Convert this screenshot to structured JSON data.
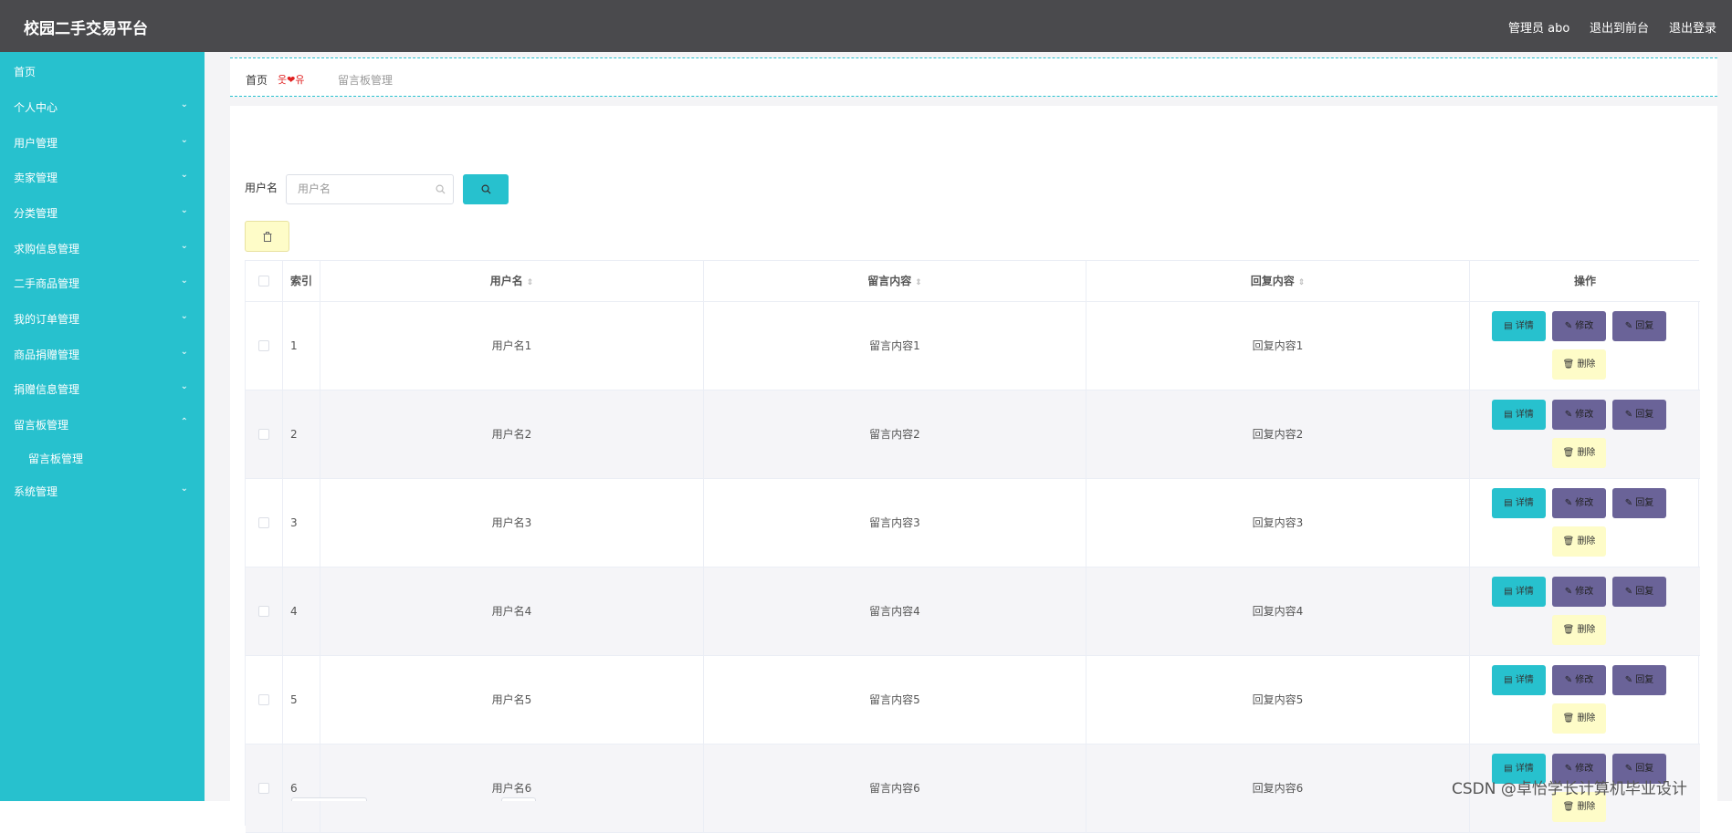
{
  "header": {
    "brand": "校园二手交易平台",
    "admin_label": "管理员 abo",
    "front_link": "退出到前台",
    "logout_link": "退出登录"
  },
  "sidebar": {
    "items": [
      {
        "label": "首页",
        "chevron": ""
      },
      {
        "label": "个人中心",
        "chevron": "⌄"
      },
      {
        "label": "用户管理",
        "chevron": "⌄"
      },
      {
        "label": "卖家管理",
        "chevron": "⌄"
      },
      {
        "label": "分类管理",
        "chevron": "⌄"
      },
      {
        "label": "求购信息管理",
        "chevron": "⌄"
      },
      {
        "label": "二手商品管理",
        "chevron": "⌄"
      },
      {
        "label": "我的订单管理",
        "chevron": "⌄"
      },
      {
        "label": "商品捐赠管理",
        "chevron": "⌄"
      },
      {
        "label": "捐赠信息管理",
        "chevron": "⌄"
      },
      {
        "label": "留言板管理",
        "chevron": "⌃"
      },
      {
        "label": "留言板管理",
        "chevron": ""
      },
      {
        "label": "系统管理",
        "chevron": "⌄"
      }
    ]
  },
  "breadcrumb": {
    "home": "首页",
    "separator": "웃❤유",
    "current": "留言板管理"
  },
  "search": {
    "label": "用户名",
    "placeholder": "用户名",
    "icon": "search-icon",
    "button_icon": "search-icon"
  },
  "toolbar": {
    "delete_icon": "trash-icon"
  },
  "table": {
    "headers": {
      "index": "索引",
      "username": "用户名",
      "message": "留言内容",
      "reply": "回复内容",
      "actions": "操作"
    },
    "action_labels": {
      "detail": "详情",
      "edit": "修改",
      "reply": "回复",
      "delete": "删除"
    },
    "rows": [
      {
        "index": "1",
        "username": "用户名1",
        "message": "留言内容1",
        "reply": "回复内容1"
      },
      {
        "index": "2",
        "username": "用户名2",
        "message": "留言内容2",
        "reply": "回复内容2"
      },
      {
        "index": "3",
        "username": "用户名3",
        "message": "留言内容3",
        "reply": "回复内容3"
      },
      {
        "index": "4",
        "username": "用户名4",
        "message": "留言内容4",
        "reply": "回复内容4"
      },
      {
        "index": "5",
        "username": "用户名5",
        "message": "留言内容5",
        "reply": "回复内容5"
      },
      {
        "index": "6",
        "username": "用户名6",
        "message": "留言内容6",
        "reply": "回复内容6"
      }
    ]
  },
  "watermark": "CSDN @卓怡学长计算机毕业设计",
  "colors": {
    "accent": "#27c1ce",
    "header_bg": "#4a4a4d",
    "edit_btn": "#6a6398",
    "delete_btn": "#fefcc8"
  }
}
